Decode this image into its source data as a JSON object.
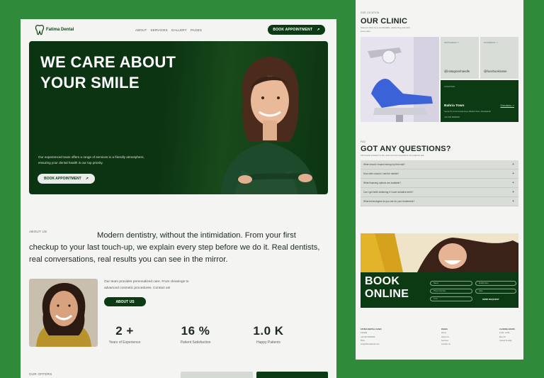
{
  "left_page": {
    "nav": {
      "brand": "Fatima Dental",
      "links": [
        "ABOUT",
        "SERVICES",
        "GALLERY",
        "PAGES"
      ],
      "cta": "BOOK APPOINTMENT",
      "cta_arrow": "↗"
    },
    "hero": {
      "title_line1": "WE CARE ABOUT",
      "title_line2": "YOUR SMILE",
      "description": "Our experienced team offers a range of services in a friendly atmosphere, ensuring your dental health is our top priority.",
      "cta": "BOOK APPOINTMENT",
      "cta_arrow": "↗"
    },
    "about": {
      "tag": "ABOUT US",
      "statement": "Modern dentistry, without the intimidation. From your first checkup to your last touch-up, we explain every step before we do it. Real dentists, real conversations, real results you can see in the mirror.",
      "description": "Our team provides personalized care. From cleanings to advanced cosmetic procedures. Contact us!",
      "cta": "ABOUT US"
    },
    "stats": [
      {
        "value": "2 +",
        "label": "Years of Experience"
      },
      {
        "value": "16 %",
        "label": "Patient Satisfaction"
      },
      {
        "value": "1.0 K",
        "label": "Happy Patients"
      }
    ],
    "offers_tag": "OUR OFFERS"
  },
  "right_page": {
    "clinic": {
      "tag": "OUR LOCATION",
      "title": "OUR CLINIC",
      "subtitle": "Visit our clinic for a comfortable, welcoming visit with every care.",
      "cards": [
        {
          "label": "INSTAGRAM ↗",
          "handle": "@instagramhandle"
        },
        {
          "label": "FACEBOOK ↗",
          "handle": "@facebookname"
        }
      ],
      "location_label": "LOCATION",
      "place": "Bahria Town",
      "directions": "Directions ↗",
      "address": "Sector B, Commercial Area, Bahria Town, Rawalpindi",
      "phone": "+92 300 0000000"
    },
    "faq": {
      "tag": "FAQ",
      "title": "GOT ANY QUESTIONS?",
      "subtitle": "Find quick answers to the most common questions our patients ask.",
      "items": [
        "What should I expect during my first visit?",
        "How often should I visit the dentist?",
        "What financing options are available?",
        "Can I get teeth whitening if I have sensitive teeth?",
        "What technologies do you use for your treatments?"
      ],
      "toggle": "+"
    },
    "booking": {
      "title_line1": "BOOK",
      "title_line2": "ONLINE",
      "fields": [
        "Name",
        "E-Mail Here",
        "Phone Number",
        "Date",
        "Time"
      ],
      "send": "SEND REQUEST"
    },
    "footer": {
      "col1_head": "FATIMA DENTAL CLINIC",
      "col1": [
        "PHONE",
        "+92 300 0000000",
        "MAIL",
        "info@fatimadental.com"
      ],
      "col2_head": "PAGES",
      "col2": [
        "Home",
        "About Us",
        "Services",
        "Contact Us"
      ],
      "col3_head": "CLOSING HOURS",
      "col3": [
        "9 AM - 6 PM",
        "Mon-Fri",
        "Closed Sunday"
      ]
    }
  },
  "colors": {
    "background": "#2f8a3a",
    "brand_dark": "#0c3a12",
    "page": "#f4f5f3",
    "panel": "#d9ddd8"
  }
}
